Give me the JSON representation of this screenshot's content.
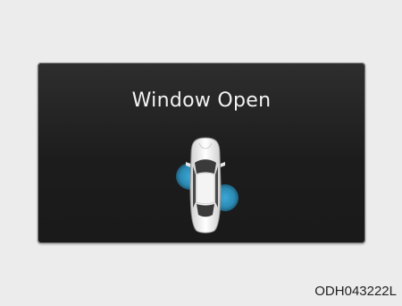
{
  "display": {
    "title": "Window Open",
    "icon": "car-top-view-icon",
    "open_windows": [
      "front-left",
      "rear-right"
    ],
    "indicator_color": "#2b8ab3"
  },
  "image_code": "ODH043222L"
}
